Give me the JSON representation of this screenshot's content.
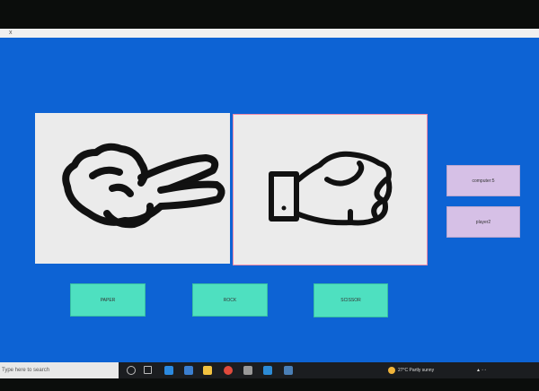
{
  "window": {
    "close_glyph": "x"
  },
  "game": {
    "computer_label": "computer:5",
    "player_label": "player2",
    "buttons": {
      "paper": "PAPER",
      "rock": "ROCK",
      "scissor": "SCISSOR"
    }
  },
  "taskbar": {
    "search_placeholder": "Type here to search",
    "weather": "27°C  Partly sunny",
    "icons": [
      "task-view-icon",
      "edge-icon",
      "store-icon",
      "file-explorer-icon",
      "chrome-icon",
      "settings-icon",
      "vscode-icon",
      "python-icon"
    ]
  },
  "colors": {
    "background": "#0d63d4",
    "label_box": "#d6c0e6",
    "button": "#4ee0c0",
    "panel": "#ebebeb"
  }
}
